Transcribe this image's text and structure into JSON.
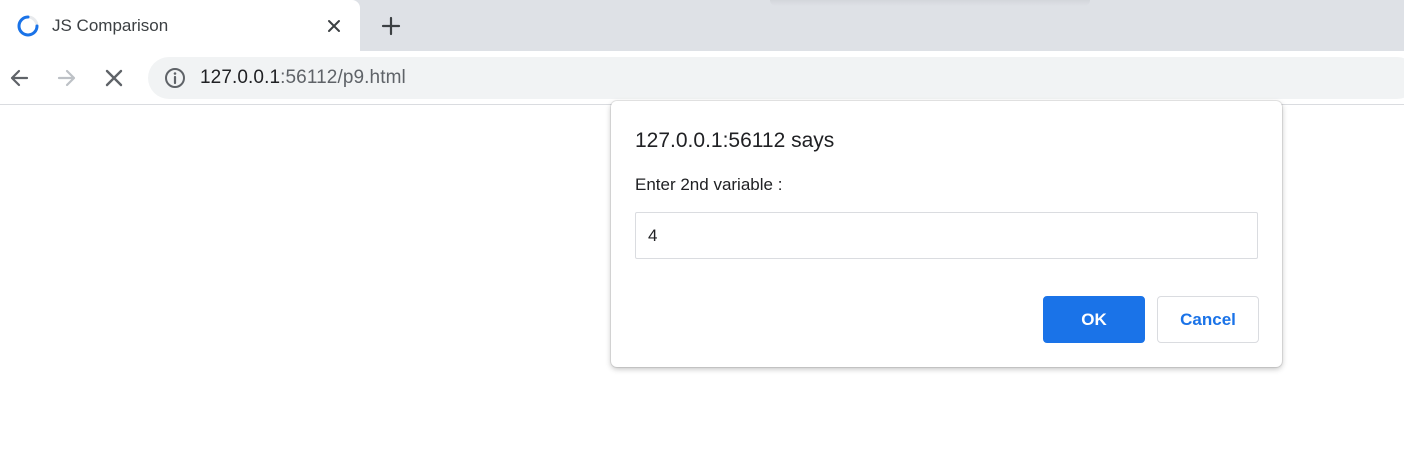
{
  "tab": {
    "title": "JS Comparison",
    "loading_icon": "loading-spinner-icon",
    "close_icon": "close-icon"
  },
  "new_tab_icon": "plus-icon",
  "toolbar": {
    "back_icon": "arrow-left-icon",
    "forward_icon": "arrow-right-icon",
    "stop_icon": "stop-icon",
    "site_info_icon": "info-icon"
  },
  "address_bar": {
    "host": "127.0.0.1",
    "rest": ":56112/p9.html"
  },
  "dialog": {
    "title": "127.0.0.1:56112 says",
    "message": "Enter 2nd variable :",
    "input_value": "4",
    "ok_label": "OK",
    "cancel_label": "Cancel"
  },
  "colors": {
    "accent": "#1a73e8",
    "tabstrip_bg": "#dee1e6",
    "omnibox_bg": "#f1f3f4"
  }
}
